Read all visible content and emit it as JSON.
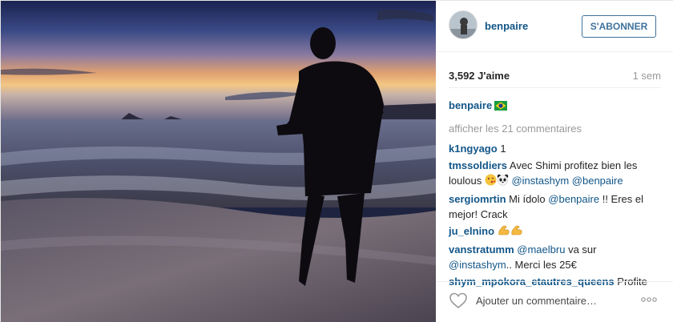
{
  "photo": {
    "alt_icon": "photo-sunset-beach"
  },
  "header": {
    "username": "benpaire",
    "follow_label": "S'ABONNER"
  },
  "stats": {
    "likes": "3,592 J'aime",
    "time": "1 sem"
  },
  "caption": {
    "username": "benpaire",
    "flag_icon": "brazil-flag-icon"
  },
  "view_all_comments": "afficher les 21 commentaires",
  "comments": [
    {
      "user": "k1ngyago",
      "text": "1"
    },
    {
      "user": "tmssoldiers",
      "text": "Avec Shimi profitez bien les loulous",
      "emojis": [
        "kiss-emoji",
        "panda-emoji"
      ],
      "mentions": [
        "@instashym",
        "@benpaire"
      ]
    },
    {
      "user": "sergiomrtin",
      "text_before": "Mi ídolo",
      "mention": "@benpaire",
      "text_after": "!! Eres el mejor! Crack"
    },
    {
      "user": "ju_elnino",
      "emojis": [
        "flexed-biceps-emoji",
        "flexed-biceps-emoji"
      ]
    },
    {
      "user": "vanstratumm",
      "mention1": "@maelbru",
      "text_mid": "va sur",
      "mention2": "@instashym",
      "text_after": ".. Merci les 25€"
    },
    {
      "user": "shym_mpokora_etautres_queens",
      "text": "Profite"
    }
  ],
  "footer": {
    "comment_placeholder": "Ajouter un commentaire…",
    "like_icon": "heart-icon",
    "more_icon": "more-options-icon"
  },
  "colors": {
    "link": "#125688",
    "follow": "#3f729b",
    "muted": "#999999"
  }
}
